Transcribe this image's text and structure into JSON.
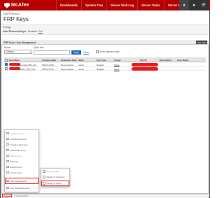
{
  "topbar": {
    "brand": "McAfee",
    "nav": [
      "Dashboards",
      "System Tree",
      "Server Task Log",
      "Server Tasks",
      "Server Settings"
    ],
    "icons": [
      "bell-icon",
      "user-icon",
      "menu-icon"
    ]
  },
  "header": {
    "breadcrumb": "Data Protection",
    "title": "FRP Keys"
  },
  "settings": {
    "label": "Settings",
    "user_personal_keys_label": "User Personal Keys:",
    "user_personal_keys_value": "Enabled",
    "edit_link": "Edit"
  },
  "panel": {
    "title": "FRP Keys / Key Management",
    "hide_filter": "Hide Filter",
    "preset_label": "Preset:",
    "preset_value": "Default",
    "quickfind_label": "Quick find:",
    "apply": "Apply",
    "clear": "Clear",
    "show_selected": "Show selected rows"
  },
  "grid": {
    "columns": [
      "Key Name",
      "Creation Date",
      "Expiration Date",
      "State",
      "Key Type",
      "Usage",
      "Key ID",
      "Description",
      "User Name"
    ],
    "rows": [
      {
        "key_name": "Personal_FRP_Key",
        "creation": "6/6/22 10:50 ...",
        "expiration": "Never expires",
        "state": "Active",
        "type": "Regular",
        "usage": "Show",
        "selected": true
      },
      {
        "key_name": "System_FRP_Key",
        "creation": "6/6/22 12:41 ...",
        "expiration": "Never expires",
        "state": "Active",
        "type": "Regular",
        "usage": "Show",
        "selected": false
      }
    ]
  },
  "actions_menu": {
    "items": [
      {
        "label": "Activate Keys",
        "disabled": true
      },
      {
        "label": "Choose Columns",
        "disabled": false
      },
      {
        "label": "Create a New Key",
        "disabled": false
      },
      {
        "label": "Deactivate Keys",
        "disabled": false
      },
      {
        "label": "Delete Keys",
        "disabled": true
      },
      {
        "label": "Edit Key",
        "disabled": false
      },
      {
        "label": "Export Keys",
        "disabled": false
      },
      {
        "label": "Import Keys",
        "disabled": false
      },
      {
        "label": "Key Assignments",
        "disabled": false,
        "highlighted": true
      },
      {
        "label": "Key Unassignments",
        "disabled": false
      }
    ],
    "submenu": [
      {
        "label": "Assign LDPA",
        "disabled": true
      },
      {
        "label": "Assign to systems",
        "disabled": false
      },
      {
        "label": "Assign to users",
        "disabled": false,
        "highlighted": true
      }
    ]
  },
  "footer": {
    "actions_label": "Actions",
    "selected_count": "1 of 2 selected"
  },
  "colors": {
    "brand_red": "#b50000",
    "highlight_red": "#e51b1b",
    "link_blue": "#1565c0"
  }
}
